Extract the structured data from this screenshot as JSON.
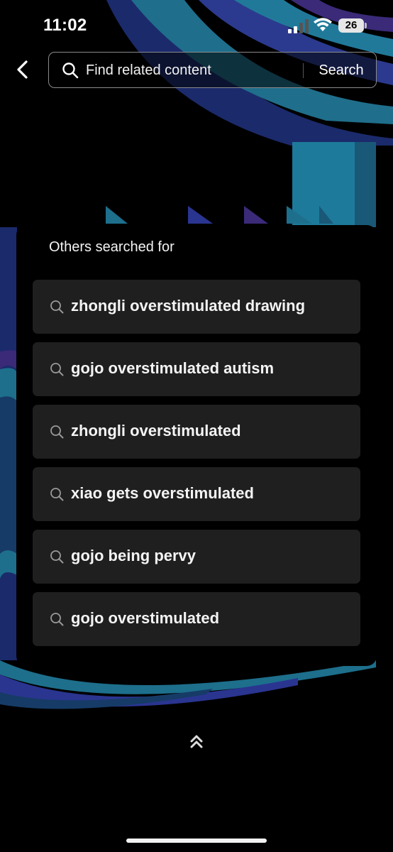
{
  "status_bar": {
    "time": "11:02",
    "battery": "26",
    "signal_icon": "cellular-signal-icon",
    "wifi_icon": "wifi-icon"
  },
  "header": {
    "back_icon": "chevron-left-icon",
    "search_placeholder": "Find related content",
    "search_icon": "search-icon",
    "search_button_label": "Search"
  },
  "suggestions": {
    "title": "Others searched for",
    "items": [
      {
        "label": "zhongli overstimulated drawing"
      },
      {
        "label": "gojo overstimulated autism"
      },
      {
        "label": "zhongli overstimulated"
      },
      {
        "label": "xiao gets overstimulated"
      },
      {
        "label": "gojo being pervy"
      },
      {
        "label": "gojo overstimulated"
      }
    ]
  },
  "footer": {
    "collapse_icon": "double-chevron-up-icon"
  },
  "colors": {
    "background": "#000000",
    "panel": "#000000",
    "suggestion_background": "#1f1f1f",
    "text": "#ffffff",
    "art_teal": "#1e6f8a",
    "art_blue": "#20236e",
    "art_purple": "#3a2a78"
  }
}
